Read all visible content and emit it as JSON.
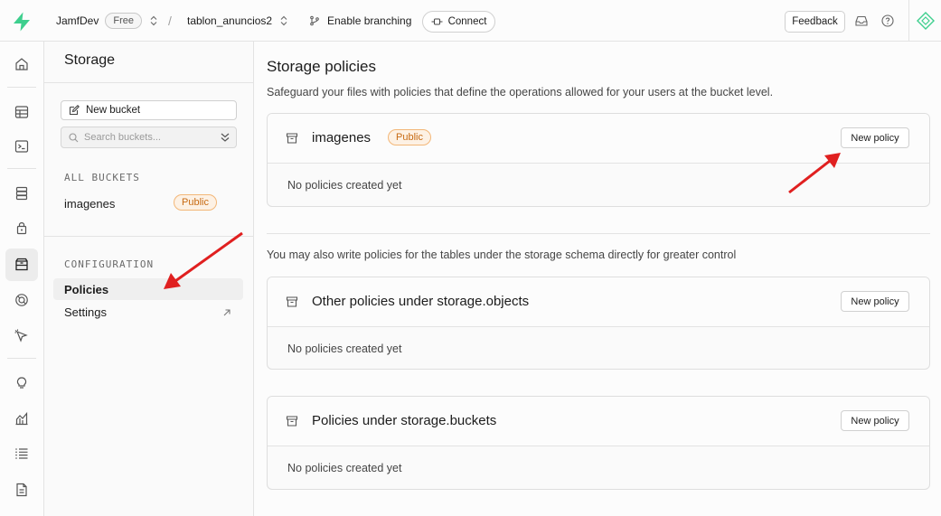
{
  "topbar": {
    "org_name": "JamfDev",
    "plan_badge": "Free",
    "separator": "/",
    "project_name": "tablon_anuncios2",
    "branching_label": "Enable branching",
    "connect_label": "Connect",
    "feedback_label": "Feedback"
  },
  "rail": {
    "icons": [
      "home-icon",
      "table-editor-icon",
      "sql-editor-icon",
      "database-icon",
      "auth-icon",
      "storage-icon",
      "realtime-icon",
      "edge-functions-icon",
      "advisors-icon",
      "reports-icon",
      "logs-icon",
      "docs-icon"
    ],
    "active": "storage-icon"
  },
  "sidebar": {
    "title": "Storage",
    "new_bucket_label": "New bucket",
    "search_placeholder": "Search buckets...",
    "all_buckets_label": "ALL BUCKETS",
    "buckets": [
      {
        "name": "imagenes",
        "badge": "Public"
      }
    ],
    "configuration_label": "CONFIGURATION",
    "config_items": [
      {
        "label": "Policies",
        "active": true
      },
      {
        "label": "Settings",
        "external": true
      }
    ]
  },
  "main": {
    "title": "Storage policies",
    "subtitle": "Safeguard your files with policies that define the operations allowed for your users at the bucket level.",
    "note": "You may also write policies for the tables under the storage schema directly for greater control",
    "cards": [
      {
        "name": "imagenes",
        "badge": "Public",
        "button": "New policy",
        "empty": "No policies created yet"
      },
      {
        "name": "Other policies under storage.objects",
        "button": "New policy",
        "empty": "No policies created yet"
      },
      {
        "name": "Policies under storage.buckets",
        "button": "New policy",
        "empty": "No policies created yet"
      }
    ]
  },
  "colors": {
    "brand_green": "#3ecf8e",
    "annotation_red": "#e02020",
    "public_badge": "#c76a12"
  }
}
